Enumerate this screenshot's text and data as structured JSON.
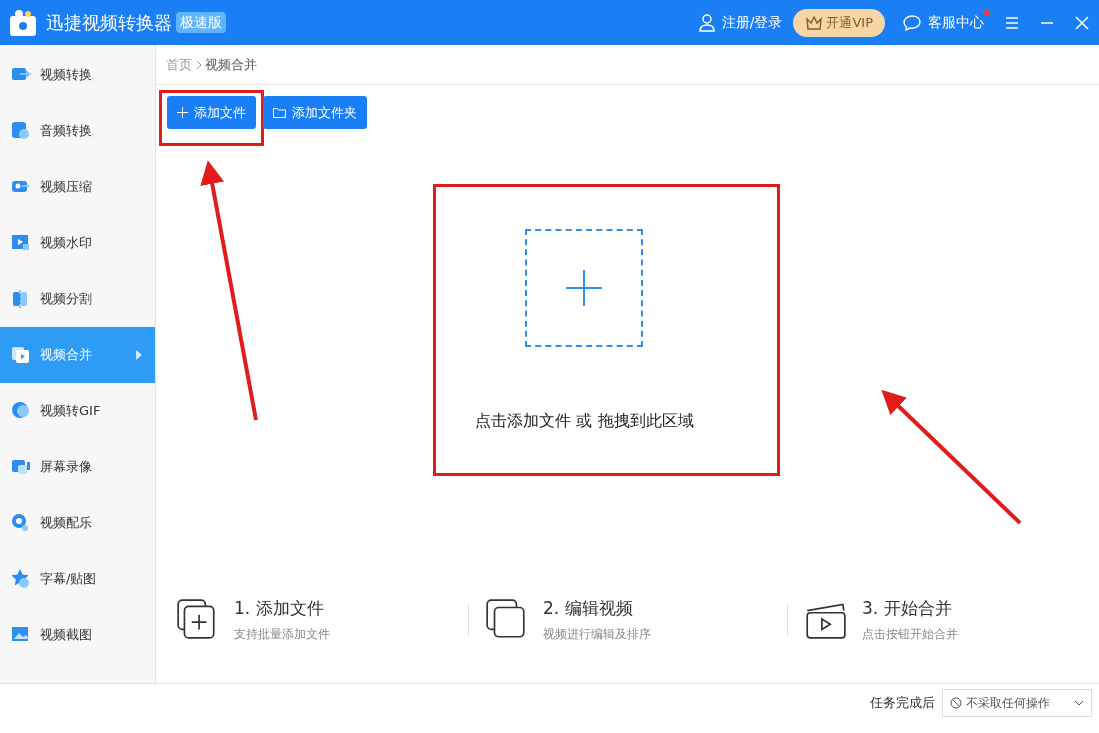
{
  "window": {
    "title": "迅捷视频转换器",
    "edition_badge": "极速版",
    "login": "注册/登录",
    "vip": "开通VIP",
    "support": "客服中心",
    "support_unread": true
  },
  "sidebar": {
    "items": [
      {
        "label": "视频转换",
        "selected": false
      },
      {
        "label": "音频转换",
        "selected": false
      },
      {
        "label": "视频压缩",
        "selected": false
      },
      {
        "label": "视频水印",
        "selected": false
      },
      {
        "label": "视频分割",
        "selected": false
      },
      {
        "label": "视频合并",
        "selected": true
      },
      {
        "label": "视频转GIF",
        "selected": false
      },
      {
        "label": "屏幕录像",
        "selected": false
      },
      {
        "label": "视频配乐",
        "selected": false
      },
      {
        "label": "字幕/贴图",
        "selected": false
      },
      {
        "label": "视频截图",
        "selected": false
      }
    ]
  },
  "breadcrumb": [
    "首页",
    "视频合并"
  ],
  "toolbar": [
    {
      "label": "添加文件",
      "highlighted": true
    },
    {
      "label": "添加文件夹",
      "highlighted": false
    }
  ],
  "drop_zone": {
    "hint": "点击添加文件 或 拖拽到此区域",
    "highlighted": true
  },
  "steps": [
    {
      "title": "1. 添加文件",
      "subtitle": "支持批量添加文件"
    },
    {
      "title": "2. 编辑视频",
      "subtitle": "视频进行编辑及排序"
    },
    {
      "title": "3. 开始合并",
      "subtitle": "点击按钮开始合并"
    }
  ],
  "footer": {
    "label": "任务完成后",
    "select": "不采取任何操作"
  }
}
